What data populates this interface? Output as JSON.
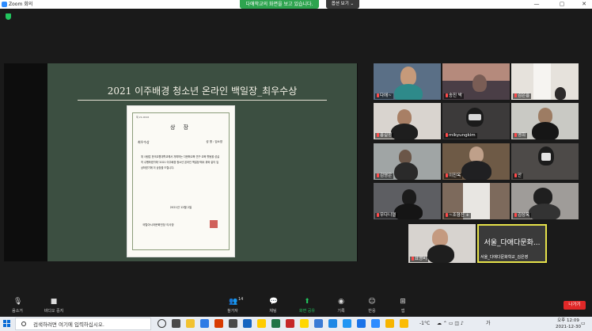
{
  "window": {
    "title": "Zoom 회의"
  },
  "banner": {
    "text": "다애학교의 화면을 보고 있습니다.",
    "view_option": "옵션 보기 ⌄"
  },
  "slide": {
    "title": "2021 이주배경 청소년 온라인 백일장_최우수상",
    "certificate": {
      "number": "제 21-0016",
      "heading": "상 장",
      "award": "최우수상",
      "name": "성 명 : 임소영",
      "body": "위 사람은 한국교원대학교에서 개최하는 다문화교육 연구·교육 활동을 성실히 수행하였기에 '2021 이주배경 청소년 온라인 백일장'에서 위와 같이 입상하였기에 이 상장을 드립니다.",
      "date": "2021년 12월 2일",
      "signer": "국립아시아문화전당 이사장"
    }
  },
  "participants": [
    {
      "name": "다애~"
    },
    {
      "name": "송진 박"
    },
    {
      "name": "김은흥"
    },
    {
      "name": "홍길정"
    },
    {
      "name": "mikyungkim"
    },
    {
      "name": "영희"
    },
    {
      "name": "김영은"
    },
    {
      "name": "이진옥"
    },
    {
      "name": "안"
    },
    {
      "name": "우다니엘"
    },
    {
      "name": "~조형진 +"
    },
    {
      "name": "김상옥"
    },
    {
      "name": "표영비"
    }
  ],
  "active_speaker": {
    "display": "서울_다애다문화...",
    "label": "서울_다애다문화학교_김은영"
  },
  "toolbar": {
    "mute": "음소거",
    "video": "비디오 중지",
    "participants": "참가자",
    "participants_count": "14",
    "chat": "채팅",
    "share": "화면 공유",
    "record": "기록",
    "reactions": "반응",
    "apps": "앱",
    "leave": "나가기"
  },
  "taskbar": {
    "search_placeholder": "검색하려면 여기에 입력하십시오.",
    "weather": "-1°C",
    "ime": "가",
    "time": "오후 12:09",
    "date": "2021-12-30"
  },
  "colors": {
    "share_green": "#22c55e",
    "leave_red": "#e02828",
    "speaker_border": "#e6e24a"
  }
}
